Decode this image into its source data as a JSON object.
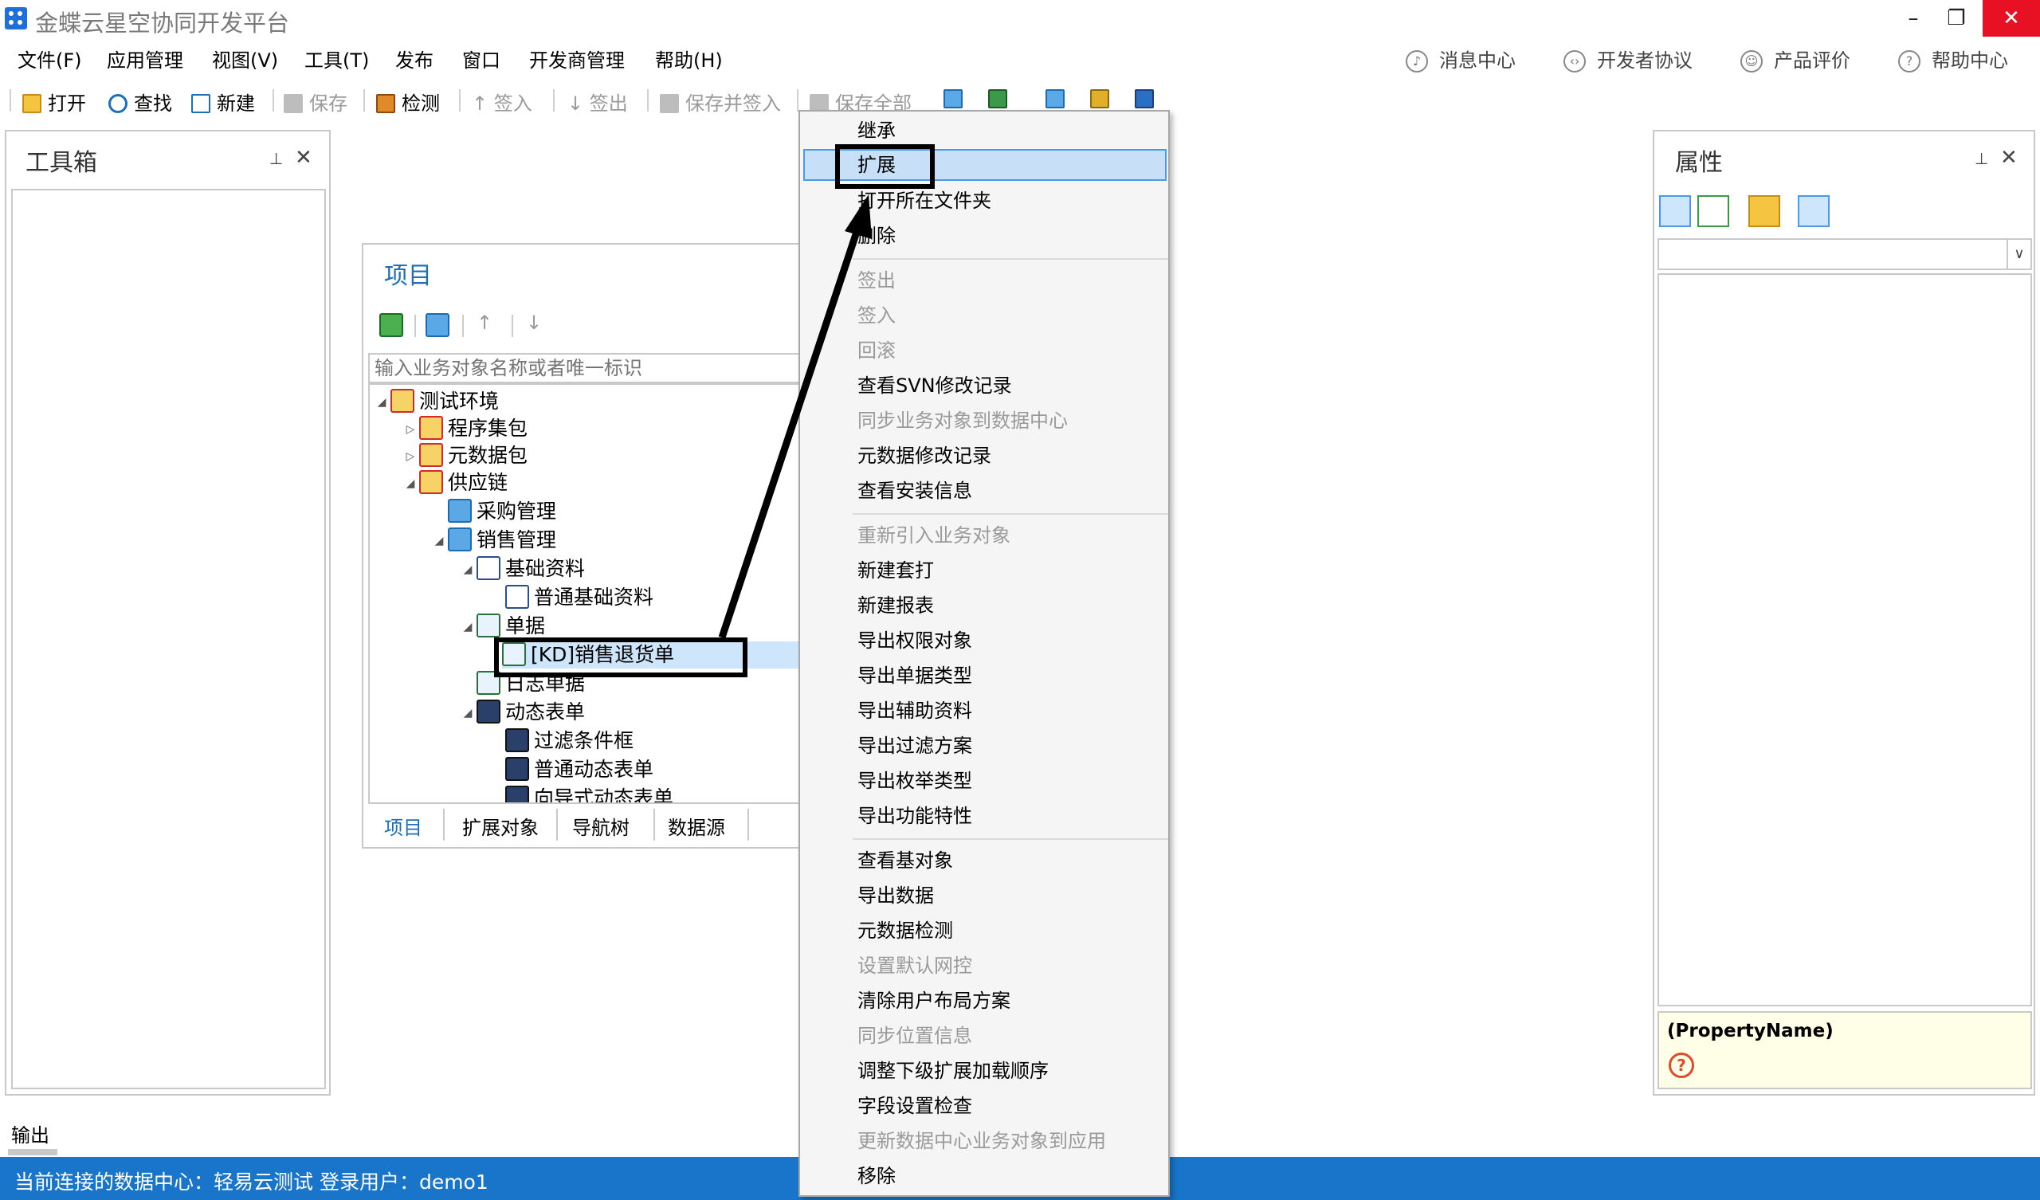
{
  "window": {
    "title": "金蝶云星空协同开发平台",
    "controls": {
      "minimize": "–",
      "restore": "❐",
      "close": "✕"
    }
  },
  "menubar": {
    "items": [
      "文件(F)",
      "应用管理",
      "视图(V)",
      "工具(T)",
      "发布",
      "窗口",
      "开发商管理",
      "帮助(H)"
    ],
    "right_links": [
      "消息中心",
      "开发者协议",
      "产品评价",
      "帮助中心"
    ]
  },
  "toolbar": {
    "open": "打开",
    "find": "查找",
    "new": "新建",
    "save": "保存",
    "check": "检测",
    "checkin": "签入",
    "checkout": "签出",
    "save_checkin": "保存并签入",
    "save_all": "保存全部"
  },
  "toolbox": {
    "title": "工具箱"
  },
  "output": {
    "label": "输出"
  },
  "project": {
    "title": "项目",
    "search_placeholder": "输入业务对象名称或者唯一标识",
    "tree": [
      {
        "label": "测试环境",
        "icon": "folder-red-icon"
      },
      {
        "label": "程序集包",
        "icon": "folder-red-icon"
      },
      {
        "label": "元数据包",
        "icon": "folder-red-icon"
      },
      {
        "label": "供应链",
        "icon": "folder-red-icon"
      },
      {
        "label": "采购管理",
        "icon": "module-icon"
      },
      {
        "label": "销售管理",
        "icon": "module-icon"
      },
      {
        "label": "基础资料",
        "icon": "basedata-icon"
      },
      {
        "label": "普通基础资料",
        "icon": "form-icon"
      },
      {
        "label": "单据",
        "icon": "bill-icon"
      },
      {
        "label": "[KD]销售退货单",
        "icon": "bill-icon"
      },
      {
        "label": "日志单据",
        "icon": "bill-icon"
      },
      {
        "label": "动态表单",
        "icon": "dynamic-form-icon"
      },
      {
        "label": "过滤条件框",
        "icon": "dynamic-form-icon"
      },
      {
        "label": "普通动态表单",
        "icon": "dynamic-form-icon"
      },
      {
        "label": "向导式动态表单",
        "icon": "dynamic-form-icon"
      }
    ],
    "tabs": [
      "项目",
      "扩展对象",
      "导航树",
      "数据源"
    ]
  },
  "properties": {
    "title": "属性",
    "desc_name": "(PropertyName)",
    "select_arrow": "∨"
  },
  "context_menu": {
    "items": [
      {
        "label": "继承",
        "enabled": true
      },
      {
        "label": "扩展",
        "enabled": true,
        "highlighted": true
      },
      {
        "label": "打开所在文件夹",
        "enabled": true
      },
      {
        "label": "删除",
        "enabled": true
      },
      {
        "label": "签出",
        "enabled": false
      },
      {
        "label": "签入",
        "enabled": false
      },
      {
        "label": "回滚",
        "enabled": false
      },
      {
        "label": "查看SVN修改记录",
        "enabled": true
      },
      {
        "label": "同步业务对象到数据中心",
        "enabled": false
      },
      {
        "label": "元数据修改记录",
        "enabled": true
      },
      {
        "label": "查看安装信息",
        "enabled": true
      },
      {
        "label": "重新引入业务对象",
        "enabled": false
      },
      {
        "label": "新建套打",
        "enabled": true
      },
      {
        "label": "新建报表",
        "enabled": true
      },
      {
        "label": "导出权限对象",
        "enabled": true
      },
      {
        "label": "导出单据类型",
        "enabled": true
      },
      {
        "label": "导出辅助资料",
        "enabled": true
      },
      {
        "label": "导出过滤方案",
        "enabled": true
      },
      {
        "label": "导出枚举类型",
        "enabled": true
      },
      {
        "label": "导出功能特性",
        "enabled": true
      },
      {
        "label": "查看基对象",
        "enabled": true
      },
      {
        "label": "导出数据",
        "enabled": true
      },
      {
        "label": "元数据检测",
        "enabled": true
      },
      {
        "label": "设置默认网控",
        "enabled": false
      },
      {
        "label": "清除用户布局方案",
        "enabled": true
      },
      {
        "label": "同步位置信息",
        "enabled": false
      },
      {
        "label": "调整下级扩展加载顺序",
        "enabled": true
      },
      {
        "label": "字段设置检查",
        "enabled": true
      },
      {
        "label": "更新数据中心业务对象到应用",
        "enabled": false
      },
      {
        "label": "移除",
        "enabled": true
      }
    ]
  },
  "statusbar": {
    "text": "当前连接的数据中心：轻易云测试  登录用户：demo1"
  },
  "colors": {
    "accent": "#1875c9",
    "link_blue": "#1d6fb8",
    "menu_highlight": "#c7e0f8",
    "close_red": "#e81123"
  }
}
